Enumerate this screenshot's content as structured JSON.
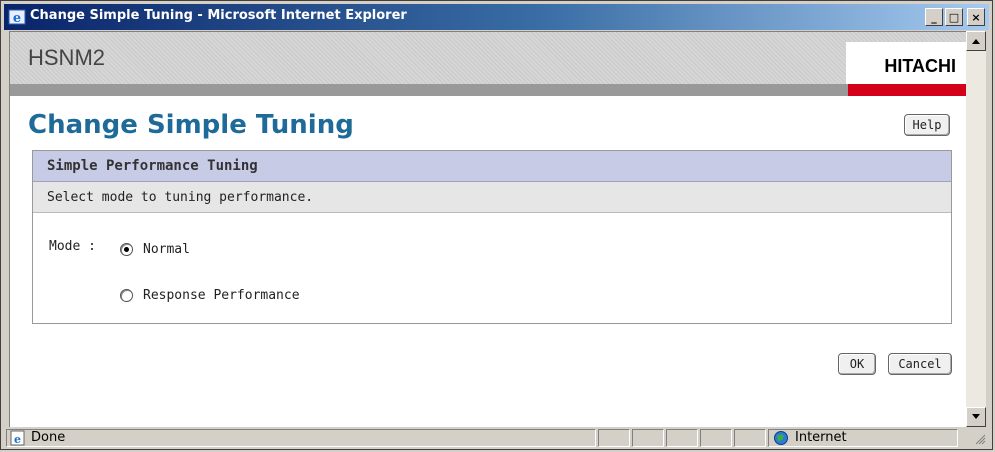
{
  "window": {
    "title": "Change Simple Tuning - Microsoft Internet Explorer",
    "minimize_glyph": "_",
    "maximize_glyph": "□",
    "close_glyph": "×"
  },
  "header": {
    "app_name": "HSNM2",
    "brand": "HITACHI",
    "brand_color": "#d4001a"
  },
  "page": {
    "title": "Change Simple Tuning",
    "title_color": "#1e6a98",
    "help_label": "Help"
  },
  "panel": {
    "heading": "Simple Performance Tuning",
    "instruction": "Select mode to tuning performance.",
    "mode_label": "Mode :",
    "options": [
      {
        "label": "Normal",
        "selected": true
      },
      {
        "label": "Response Performance",
        "selected": false
      }
    ]
  },
  "actions": {
    "ok_label": "OK",
    "cancel_label": "Cancel"
  },
  "statusbar": {
    "status_text": "Done",
    "zone_text": "Internet"
  }
}
